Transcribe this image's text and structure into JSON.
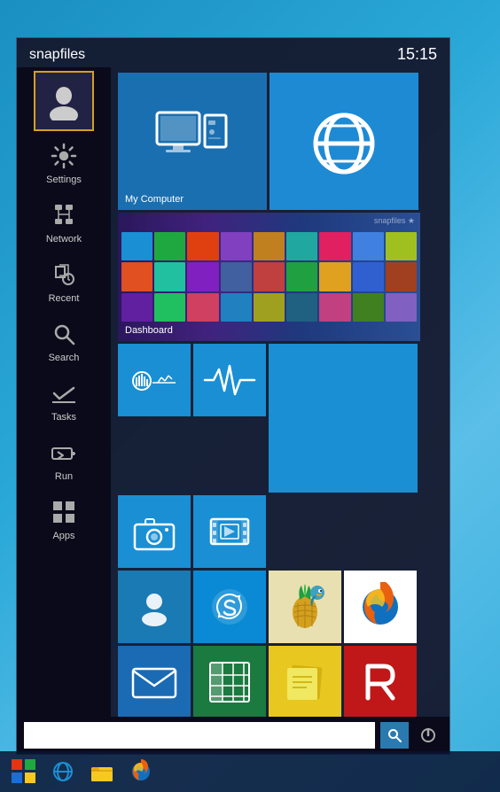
{
  "app": {
    "title": "snapfiles",
    "time": "15:15"
  },
  "sidebar": {
    "user_icon": "user-icon",
    "items": [
      {
        "id": "settings",
        "label": "Settings",
        "icon": "gear-icon"
      },
      {
        "id": "network",
        "label": "Network",
        "icon": "network-icon"
      },
      {
        "id": "recent",
        "label": "Recent",
        "icon": "recent-icon"
      },
      {
        "id": "search",
        "label": "Search",
        "icon": "search-icon"
      },
      {
        "id": "tasks",
        "label": "Tasks",
        "icon": "tasks-icon"
      },
      {
        "id": "run",
        "label": "Run",
        "icon": "run-icon"
      },
      {
        "id": "apps",
        "label": "Apps",
        "icon": "apps-icon"
      }
    ]
  },
  "tiles": {
    "row1": [
      {
        "id": "my-computer",
        "label": "My Computer",
        "color": "#1a6fb0",
        "icon": "computer-icon"
      },
      {
        "id": "internet-explorer",
        "label": "",
        "color": "#1e8ad4",
        "icon": "ie-icon"
      }
    ],
    "row2": [
      {
        "id": "dashboard",
        "label": "Dashboard",
        "color": "#3a1a6a",
        "icon": "dashboard-icon"
      }
    ],
    "row3": [
      {
        "id": "tile-stats",
        "label": "",
        "color": "#1a8fd4",
        "icon": "stats-icon"
      },
      {
        "id": "tile-pulse",
        "label": "",
        "color": "#1a8fd4",
        "icon": "pulse-icon"
      },
      {
        "id": "tile-blue-large",
        "label": "",
        "color": "#1a8fd4",
        "icon": ""
      }
    ],
    "row4": [
      {
        "id": "tile-camera",
        "label": "",
        "color": "#1a8fd4",
        "icon": "camera-icon"
      },
      {
        "id": "tile-film",
        "label": "",
        "color": "#1a8fd4",
        "icon": "film-icon"
      }
    ],
    "row5": [
      {
        "id": "tile-contact",
        "label": "",
        "color": "#1a7ab4",
        "icon": "contact-icon"
      },
      {
        "id": "tile-skype",
        "label": "",
        "color": "#0a8ad4",
        "icon": "skype-icon"
      },
      {
        "id": "tile-fruity",
        "label": "",
        "color": "#f0f0f0",
        "icon": "fruity-icon"
      },
      {
        "id": "tile-firefox",
        "label": "",
        "color": "#e86010",
        "icon": "firefox-icon"
      }
    ],
    "row6": [
      {
        "id": "tile-mail",
        "label": "",
        "color": "#1a6ab4",
        "icon": "mail-icon"
      },
      {
        "id": "tile-excel",
        "label": "",
        "color": "#1a7a40",
        "icon": "excel-icon"
      },
      {
        "id": "tile-notes",
        "label": "",
        "color": "#e8c820",
        "icon": "notes-icon"
      },
      {
        "id": "tile-revo",
        "label": "",
        "color": "#c01818",
        "icon": "revo-icon"
      }
    ]
  },
  "bottom_bar": {
    "search_placeholder": "",
    "search_label": "search",
    "power_label": "power"
  },
  "taskbar": {
    "items": [
      {
        "id": "start",
        "label": "Start",
        "icon": "windows-logo"
      },
      {
        "id": "ie",
        "label": "Internet Explorer",
        "icon": "ie-taskbar-icon"
      },
      {
        "id": "explorer",
        "label": "File Explorer",
        "icon": "explorer-taskbar-icon"
      },
      {
        "id": "firefox",
        "label": "Firefox",
        "icon": "firefox-taskbar-icon"
      }
    ]
  }
}
